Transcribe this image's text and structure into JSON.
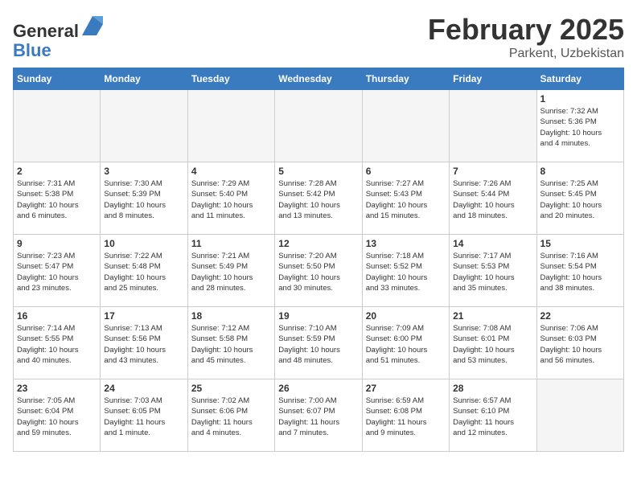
{
  "header": {
    "logo_general": "General",
    "logo_blue": "Blue",
    "month_title": "February 2025",
    "location": "Parkent, Uzbekistan"
  },
  "weekdays": [
    "Sunday",
    "Monday",
    "Tuesday",
    "Wednesday",
    "Thursday",
    "Friday",
    "Saturday"
  ],
  "weeks": [
    [
      {
        "day": "",
        "info": "",
        "empty": true
      },
      {
        "day": "",
        "info": "",
        "empty": true
      },
      {
        "day": "",
        "info": "",
        "empty": true
      },
      {
        "day": "",
        "info": "",
        "empty": true
      },
      {
        "day": "",
        "info": "",
        "empty": true
      },
      {
        "day": "",
        "info": "",
        "empty": true
      },
      {
        "day": "1",
        "info": "Sunrise: 7:32 AM\nSunset: 5:36 PM\nDaylight: 10 hours\nand 4 minutes.",
        "empty": false
      }
    ],
    [
      {
        "day": "2",
        "info": "Sunrise: 7:31 AM\nSunset: 5:38 PM\nDaylight: 10 hours\nand 6 minutes.",
        "empty": false
      },
      {
        "day": "3",
        "info": "Sunrise: 7:30 AM\nSunset: 5:39 PM\nDaylight: 10 hours\nand 8 minutes.",
        "empty": false
      },
      {
        "day": "4",
        "info": "Sunrise: 7:29 AM\nSunset: 5:40 PM\nDaylight: 10 hours\nand 11 minutes.",
        "empty": false
      },
      {
        "day": "5",
        "info": "Sunrise: 7:28 AM\nSunset: 5:42 PM\nDaylight: 10 hours\nand 13 minutes.",
        "empty": false
      },
      {
        "day": "6",
        "info": "Sunrise: 7:27 AM\nSunset: 5:43 PM\nDaylight: 10 hours\nand 15 minutes.",
        "empty": false
      },
      {
        "day": "7",
        "info": "Sunrise: 7:26 AM\nSunset: 5:44 PM\nDaylight: 10 hours\nand 18 minutes.",
        "empty": false
      },
      {
        "day": "8",
        "info": "Sunrise: 7:25 AM\nSunset: 5:45 PM\nDaylight: 10 hours\nand 20 minutes.",
        "empty": false
      }
    ],
    [
      {
        "day": "9",
        "info": "Sunrise: 7:23 AM\nSunset: 5:47 PM\nDaylight: 10 hours\nand 23 minutes.",
        "empty": false
      },
      {
        "day": "10",
        "info": "Sunrise: 7:22 AM\nSunset: 5:48 PM\nDaylight: 10 hours\nand 25 minutes.",
        "empty": false
      },
      {
        "day": "11",
        "info": "Sunrise: 7:21 AM\nSunset: 5:49 PM\nDaylight: 10 hours\nand 28 minutes.",
        "empty": false
      },
      {
        "day": "12",
        "info": "Sunrise: 7:20 AM\nSunset: 5:50 PM\nDaylight: 10 hours\nand 30 minutes.",
        "empty": false
      },
      {
        "day": "13",
        "info": "Sunrise: 7:18 AM\nSunset: 5:52 PM\nDaylight: 10 hours\nand 33 minutes.",
        "empty": false
      },
      {
        "day": "14",
        "info": "Sunrise: 7:17 AM\nSunset: 5:53 PM\nDaylight: 10 hours\nand 35 minutes.",
        "empty": false
      },
      {
        "day": "15",
        "info": "Sunrise: 7:16 AM\nSunset: 5:54 PM\nDaylight: 10 hours\nand 38 minutes.",
        "empty": false
      }
    ],
    [
      {
        "day": "16",
        "info": "Sunrise: 7:14 AM\nSunset: 5:55 PM\nDaylight: 10 hours\nand 40 minutes.",
        "empty": false
      },
      {
        "day": "17",
        "info": "Sunrise: 7:13 AM\nSunset: 5:56 PM\nDaylight: 10 hours\nand 43 minutes.",
        "empty": false
      },
      {
        "day": "18",
        "info": "Sunrise: 7:12 AM\nSunset: 5:58 PM\nDaylight: 10 hours\nand 45 minutes.",
        "empty": false
      },
      {
        "day": "19",
        "info": "Sunrise: 7:10 AM\nSunset: 5:59 PM\nDaylight: 10 hours\nand 48 minutes.",
        "empty": false
      },
      {
        "day": "20",
        "info": "Sunrise: 7:09 AM\nSunset: 6:00 PM\nDaylight: 10 hours\nand 51 minutes.",
        "empty": false
      },
      {
        "day": "21",
        "info": "Sunrise: 7:08 AM\nSunset: 6:01 PM\nDaylight: 10 hours\nand 53 minutes.",
        "empty": false
      },
      {
        "day": "22",
        "info": "Sunrise: 7:06 AM\nSunset: 6:03 PM\nDaylight: 10 hours\nand 56 minutes.",
        "empty": false
      }
    ],
    [
      {
        "day": "23",
        "info": "Sunrise: 7:05 AM\nSunset: 6:04 PM\nDaylight: 10 hours\nand 59 minutes.",
        "empty": false
      },
      {
        "day": "24",
        "info": "Sunrise: 7:03 AM\nSunset: 6:05 PM\nDaylight: 11 hours\nand 1 minute.",
        "empty": false
      },
      {
        "day": "25",
        "info": "Sunrise: 7:02 AM\nSunset: 6:06 PM\nDaylight: 11 hours\nand 4 minutes.",
        "empty": false
      },
      {
        "day": "26",
        "info": "Sunrise: 7:00 AM\nSunset: 6:07 PM\nDaylight: 11 hours\nand 7 minutes.",
        "empty": false
      },
      {
        "day": "27",
        "info": "Sunrise: 6:59 AM\nSunset: 6:08 PM\nDaylight: 11 hours\nand 9 minutes.",
        "empty": false
      },
      {
        "day": "28",
        "info": "Sunrise: 6:57 AM\nSunset: 6:10 PM\nDaylight: 11 hours\nand 12 minutes.",
        "empty": false
      },
      {
        "day": "",
        "info": "",
        "empty": true
      }
    ]
  ]
}
